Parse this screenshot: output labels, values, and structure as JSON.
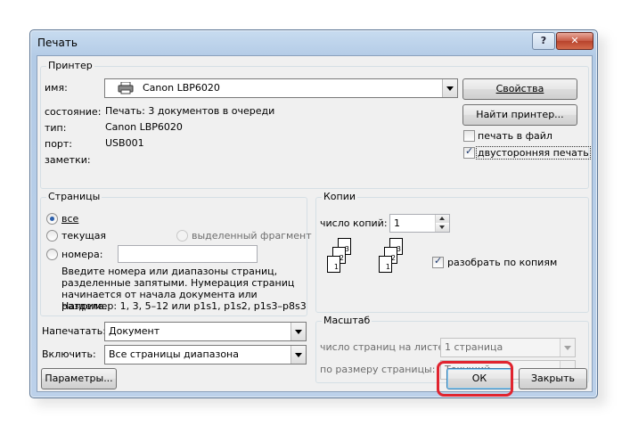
{
  "window": {
    "title": "Печать",
    "help_label": "?",
    "close_label": "✕"
  },
  "printer": {
    "group_label": "Принтер",
    "name_label": "имя:",
    "name_value": "Canon LBP6020",
    "status_label": "состояние:",
    "status_value": "Печать: 3 документов в очереди",
    "type_label": "тип:",
    "type_value": "Canon LBP6020",
    "port_label": "порт:",
    "port_value": "USB001",
    "notes_label": "заметки:",
    "properties_button": "Свойства",
    "find_printer_button": "Найти принтер...",
    "print_to_file_label": "печать в файл",
    "print_to_file_checked": false,
    "duplex_label": "двусторонняя печать",
    "duplex_checked": true
  },
  "pages": {
    "group_label": "Страницы",
    "all_label": "все",
    "current_label": "текущая",
    "selection_label": "выделенный фрагмент",
    "numbers_label": "номера:",
    "selected": "all",
    "numbers_value": "",
    "hint": "Введите номера или диапазоны страниц, разделенные запятыми. Нумерация страниц начинается от начала документа или раздела.",
    "example": "Например: 1, 3, 5–12 или p1s1, p1s2, p1s3–p8s3"
  },
  "print_what": {
    "label": "Напечатать:",
    "value": "Документ"
  },
  "include": {
    "label": "Включить:",
    "value": "Все страницы диапазона"
  },
  "copies": {
    "group_label": "Копии",
    "count_label": "число копий:",
    "count_value": "1",
    "collate_label": "разобрать по копиям",
    "collate_checked": true,
    "page_numbers": [
      "1",
      "2",
      "3"
    ]
  },
  "zoom": {
    "group_label": "Масштаб",
    "pages_per_sheet_label": "число страниц на листе:",
    "pages_per_sheet_value": "1 страница",
    "scale_label": "по размеру страницы:",
    "scale_value": "Текущий"
  },
  "footer": {
    "options_button": "Параметры...",
    "ok_button": "ОК",
    "close_button": "Закрыть"
  },
  "colors": {
    "highlight": "#e0242f",
    "title_bar": "#bcd1ea",
    "body": "#f0f0f0"
  }
}
